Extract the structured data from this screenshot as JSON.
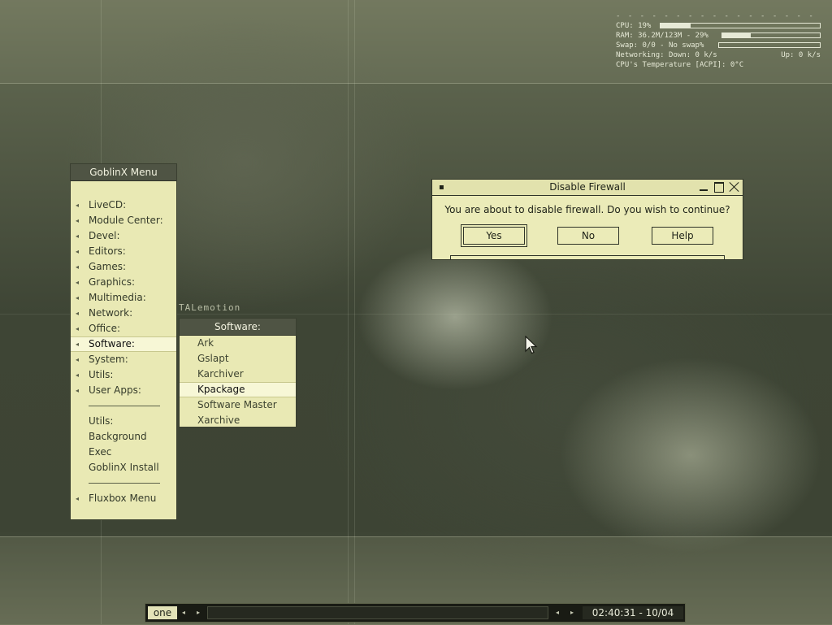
{
  "sysmon": {
    "cpu_label": "CPU: 19%",
    "cpu_fraction": 0.19,
    "ram_label": "RAM: 36.2M/123M - 29%",
    "ram_fraction": 0.29,
    "swap_label": "Swap: 0/0 - No swap%",
    "swap_fraction": 0,
    "net_label": "Networking: Down: 0 k/s",
    "net_up": "Up: 0 k/s",
    "temp_label": "CPU's Temperature [ACPI]:  0°C"
  },
  "wallpaper": {
    "text": "TALemotion"
  },
  "main_menu": {
    "title": "GoblinX Menu",
    "items": [
      {
        "label": "LiveCD:"
      },
      {
        "label": "Module Center:"
      },
      {
        "label": "Devel:"
      },
      {
        "label": "Editors:"
      },
      {
        "label": "Games:"
      },
      {
        "label": "Graphics:"
      },
      {
        "label": "Multimedia:"
      },
      {
        "label": "Network:"
      },
      {
        "label": "Office:"
      },
      {
        "label": "Software:"
      },
      {
        "label": "System:"
      },
      {
        "label": "Utils:"
      },
      {
        "label": "User Apps:"
      }
    ],
    "extra_items": [
      {
        "label": "Utils:"
      },
      {
        "label": "Background"
      },
      {
        "label": "Exec"
      },
      {
        "label": "GoblinX Install"
      }
    ],
    "footer_item": {
      "label": "Fluxbox Menu"
    }
  },
  "software_menu": {
    "title": "Software:",
    "items": [
      {
        "label": "Ark"
      },
      {
        "label": "Gslapt"
      },
      {
        "label": "Karchiver"
      },
      {
        "label": "Kpackage"
      },
      {
        "label": "Software Master"
      },
      {
        "label": "Xarchive"
      }
    ]
  },
  "dialog": {
    "title": "Disable Firewall",
    "message": "You are about to disable firewall. Do you wish to continue?",
    "yes_label": "Yes",
    "no_label": "No",
    "help_label": "Help"
  },
  "toolbar": {
    "workspace": "one",
    "clock": "02:40:31 - 10/04"
  },
  "colors": {
    "menu_bg": "#e9e9b4",
    "menu_title_bg": "#4f5444",
    "dialog_bg": "#ebebb8",
    "toolbar_bg": "#191b14"
  }
}
